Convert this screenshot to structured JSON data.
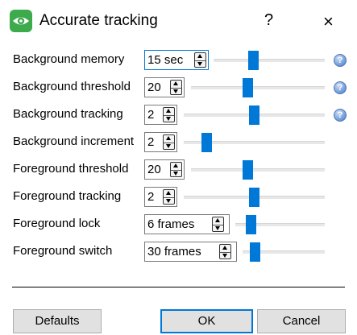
{
  "window": {
    "title": "Accurate tracking",
    "help_glyph": "?",
    "close_glyph": "×",
    "icon": "eye-icon",
    "accent": "#0078d7",
    "icon_color": "#3daa4c"
  },
  "settings": [
    {
      "label": "Background memory",
      "value": "15 sec",
      "slider": 0.38,
      "info": true,
      "focused": true
    },
    {
      "label": "Background threshold",
      "value": "20",
      "slider": 0.35,
      "info": true
    },
    {
      "label": "Background tracking",
      "value": "2",
      "slider": 0.5,
      "info": true
    },
    {
      "label": "Background increment",
      "value": "2",
      "slider": 0.18,
      "info": false
    },
    {
      "label": "Foreground threshold",
      "value": "20",
      "slider": 0.34,
      "info": false
    },
    {
      "label": "Foreground tracking",
      "value": "2",
      "slider": 0.5,
      "info": false
    },
    {
      "label": "Foreground lock",
      "value": "6 frames",
      "slider": 0.07,
      "info": false
    },
    {
      "label": "Foreground switch",
      "value": "30 frames",
      "slider": 0.1,
      "info": false
    }
  ],
  "buttons": {
    "defaults": "Defaults",
    "ok": "OK",
    "cancel": "Cancel"
  }
}
